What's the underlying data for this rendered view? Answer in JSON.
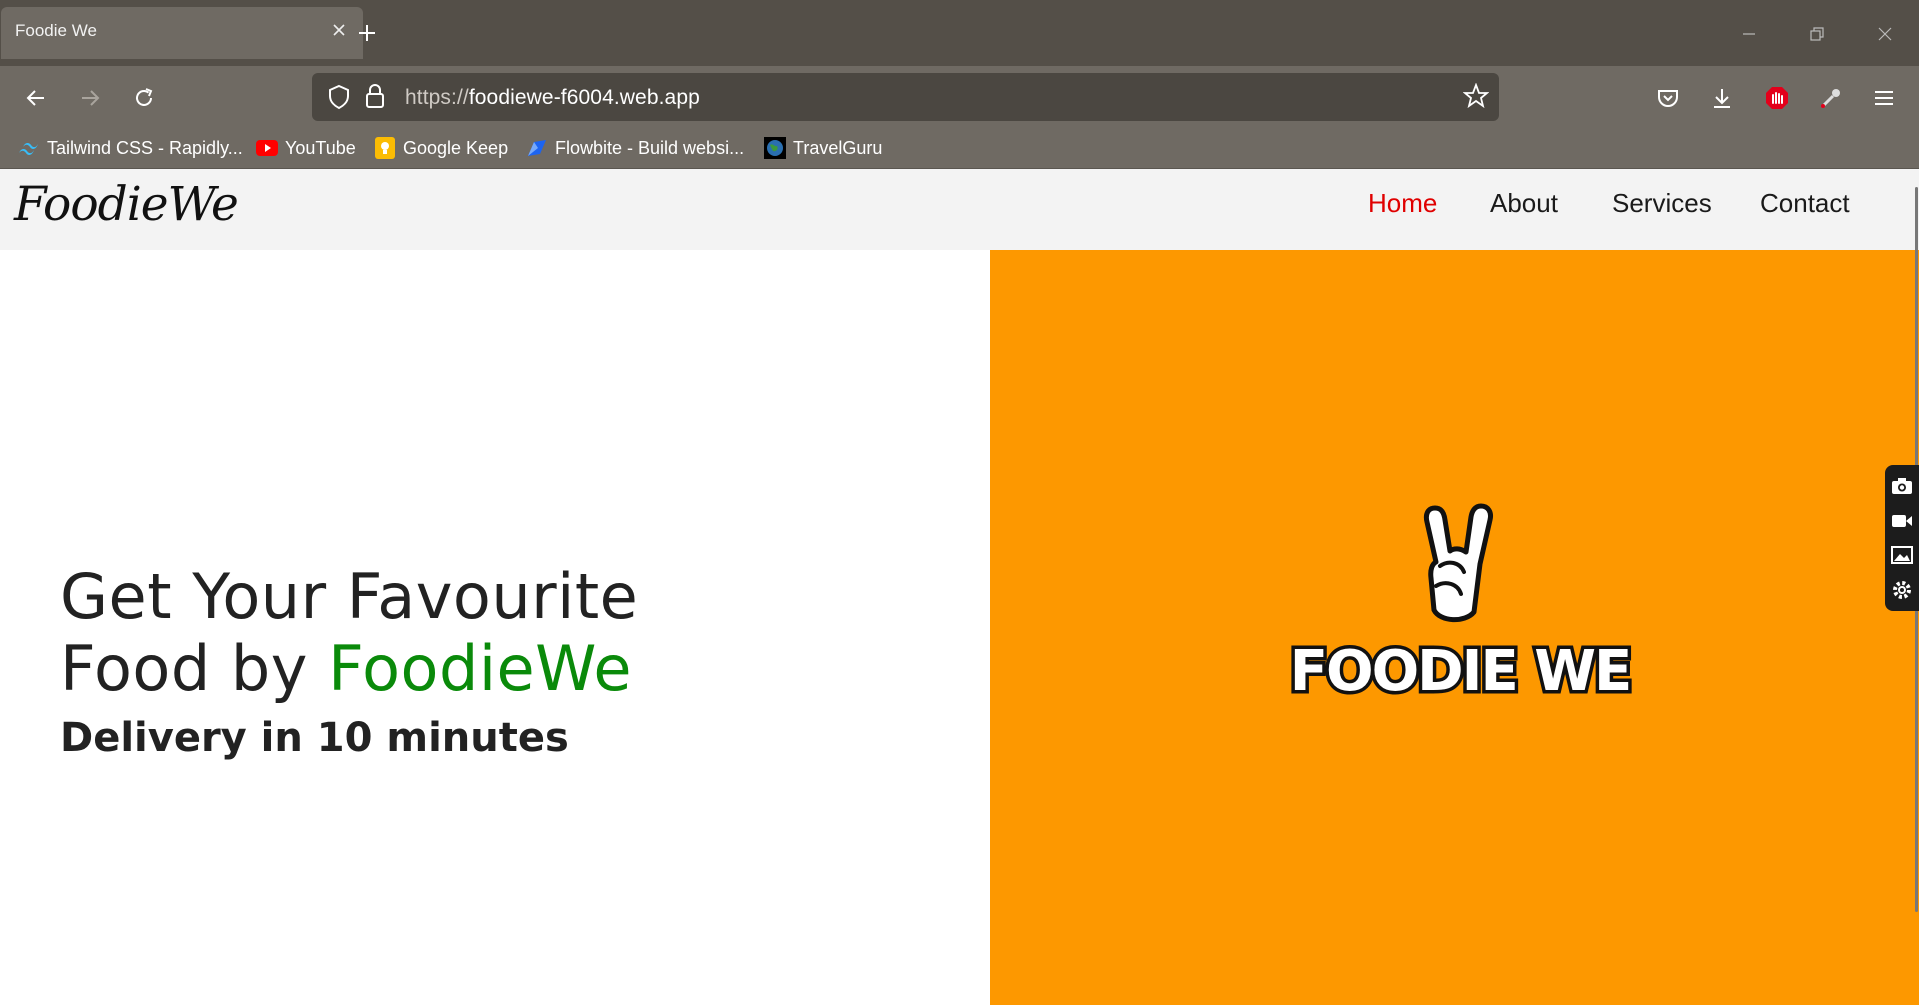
{
  "browser": {
    "tab_title": "Foodie We",
    "url_protocol": "https://",
    "url_host": "foodiewe-f6004.web.app",
    "bookmarks": [
      {
        "label": "Tailwind CSS - Rapidly...",
        "icon": "tailwind-icon"
      },
      {
        "label": "YouTube",
        "icon": "youtube-icon"
      },
      {
        "label": "Google Keep",
        "icon": "keep-icon"
      },
      {
        "label": "Flowbite - Build websi...",
        "icon": "flowbite-icon"
      },
      {
        "label": "TravelGuru",
        "icon": "globe-icon"
      }
    ]
  },
  "site": {
    "logo": "FoodieWe",
    "nav": [
      {
        "label": "Home",
        "active": true
      },
      {
        "label": "About",
        "active": false
      },
      {
        "label": "Services",
        "active": false
      },
      {
        "label": "Contact",
        "active": false
      }
    ],
    "hero": {
      "line1": "Get Your Favourite",
      "line2_prefix": "Food by ",
      "line2_brand": "FoodieWe",
      "subtitle": "Delivery in 10 minutes"
    },
    "panel_logo_text": "FOODIE WE"
  },
  "colors": {
    "accent_active": "#e00000",
    "brand_green": "#0a8a0a",
    "panel_orange": "#fd9800"
  }
}
